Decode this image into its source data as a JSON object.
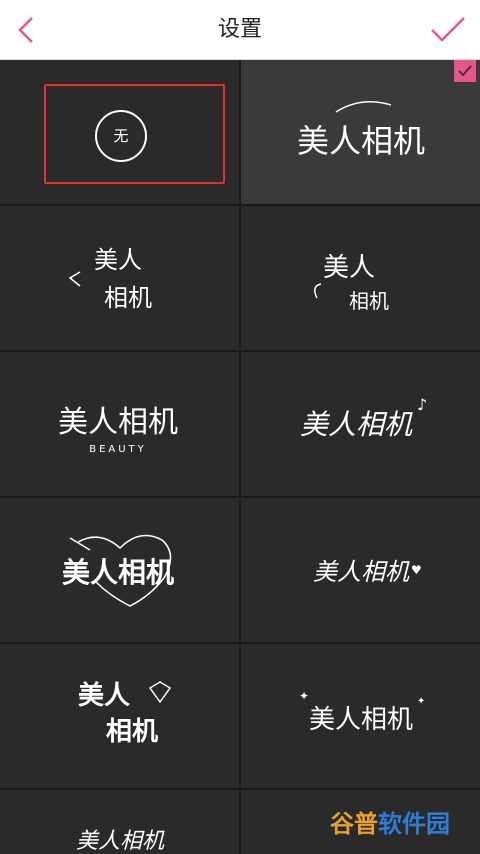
{
  "header": {
    "title": "设置"
  },
  "none_option": {
    "label": "无"
  },
  "templates": [
    {
      "main": "美人相机",
      "sub": ""
    },
    {
      "main": "美人",
      "sub": "相机"
    },
    {
      "main": "美人",
      "sub": "相机"
    },
    {
      "main": "美人相机",
      "sub": "BEAUTY"
    },
    {
      "main": "美人相机",
      "sub": ""
    },
    {
      "main": "美人相机",
      "sub": ""
    },
    {
      "main": "美人相机",
      "sub": ""
    },
    {
      "main": "美人",
      "sub": "相机"
    },
    {
      "main": "美人相机",
      "sub": ""
    },
    {
      "main": "美人相机",
      "sub": ""
    }
  ],
  "watermark": {
    "part_a": "谷普",
    "part_b": "软件园"
  },
  "colors": {
    "accent": "#e8558a",
    "selection_border": "#e53030",
    "brand_a": "#e8a22a",
    "brand_b": "#2e7dd6"
  }
}
